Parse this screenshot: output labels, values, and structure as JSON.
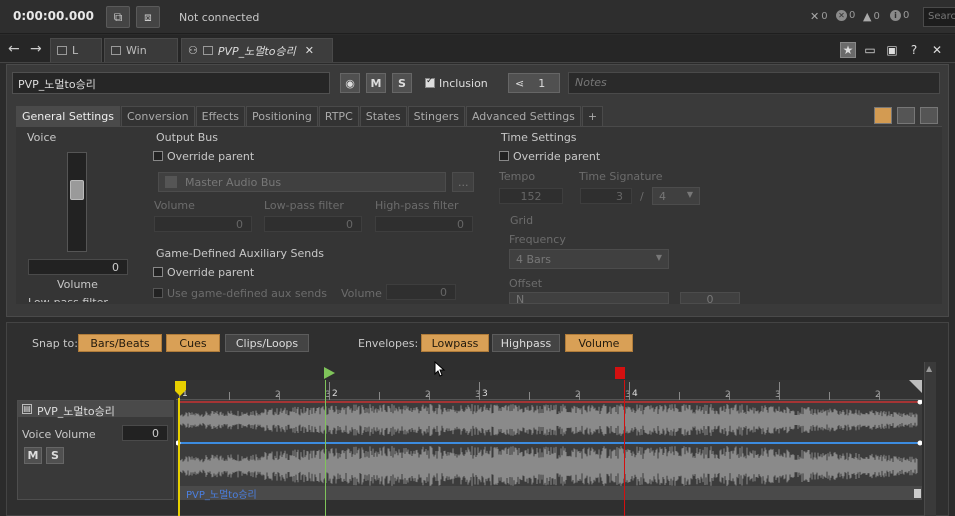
{
  "topbar": {
    "clock": "0:00:00.000",
    "status": "Not connected",
    "counters": [
      "0",
      "0",
      "0",
      "0"
    ],
    "search_placeholder": "Searc"
  },
  "tabs": [
    {
      "label": "L"
    },
    {
      "label": "Win"
    },
    {
      "label": "PVP_노멀to승리"
    }
  ],
  "header": {
    "object_name": "PVP_노멀to승리",
    "m_label": "M",
    "s_label": "S",
    "inclusion_label": "Inclusion",
    "share_count": "1",
    "notes_placeholder": "Notes"
  },
  "settings_tabs": [
    "General Settings",
    "Conversion",
    "Effects",
    "Positioning",
    "RTPC",
    "States",
    "Stingers",
    "Advanced Settings",
    "+"
  ],
  "voice": {
    "title": "Voice",
    "value": "0",
    "volume_label": "Volume",
    "lowpass_label": "Low-pass filter"
  },
  "output_bus": {
    "title": "Output Bus",
    "override_label": "Override parent",
    "bus_name": "Master Audio Bus",
    "browse_label": "...",
    "volume_label": "Volume",
    "volume_value": "0",
    "lowpass_label": "Low-pass filter",
    "lowpass_value": "0",
    "highpass_label": "High-pass filter",
    "highpass_value": "0"
  },
  "aux_sends": {
    "title": "Game-Defined Auxiliary Sends",
    "override_label": "Override parent",
    "use_label": "Use game-defined aux sends",
    "volume_label": "Volume",
    "volume_value": "0"
  },
  "time_settings": {
    "title": "Time Settings",
    "override_label": "Override parent",
    "tempo_label": "Tempo",
    "tempo_value": "152",
    "signature_label": "Time Signature",
    "sig_num": "3",
    "sig_sep": "/",
    "sig_den": "4",
    "grid_label": "Grid",
    "frequency_label": "Frequency",
    "frequency_value": "4 Bars",
    "offset_label": "Offset",
    "offset_value": "N",
    "offset_value2": "0"
  },
  "timeline": {
    "snap_label": "Snap to:",
    "snap_buttons": [
      "Bars/Beats",
      "Cues",
      "Clips/Loops"
    ],
    "envelopes_label": "Envelopes:",
    "envelope_buttons": [
      "Lowpass",
      "Highpass",
      "Volume"
    ],
    "ruler_ticks": [
      "1",
      "2",
      "3",
      "1",
      "2",
      "3",
      "1",
      "2",
      "3",
      "1",
      "2",
      "3",
      "1",
      "2",
      "3"
    ],
    "ruler_bars": [
      "1",
      "2",
      "3",
      "4"
    ],
    "track_name": "PVP_노멀to승리",
    "voice_volume_label": "Voice Volume",
    "voice_volume_value": "0",
    "m_label": "M",
    "s_label": "S",
    "clip_label": "PVP_노멀to승리"
  },
  "colors": {
    "accent_orange": "#d9a056",
    "entry_cue": "#e8d000",
    "sync_cue": "#7fc45a",
    "exit_cue": "#d41010",
    "envelope_red": "#c83232",
    "envelope_blue": "#3c8ce0"
  }
}
